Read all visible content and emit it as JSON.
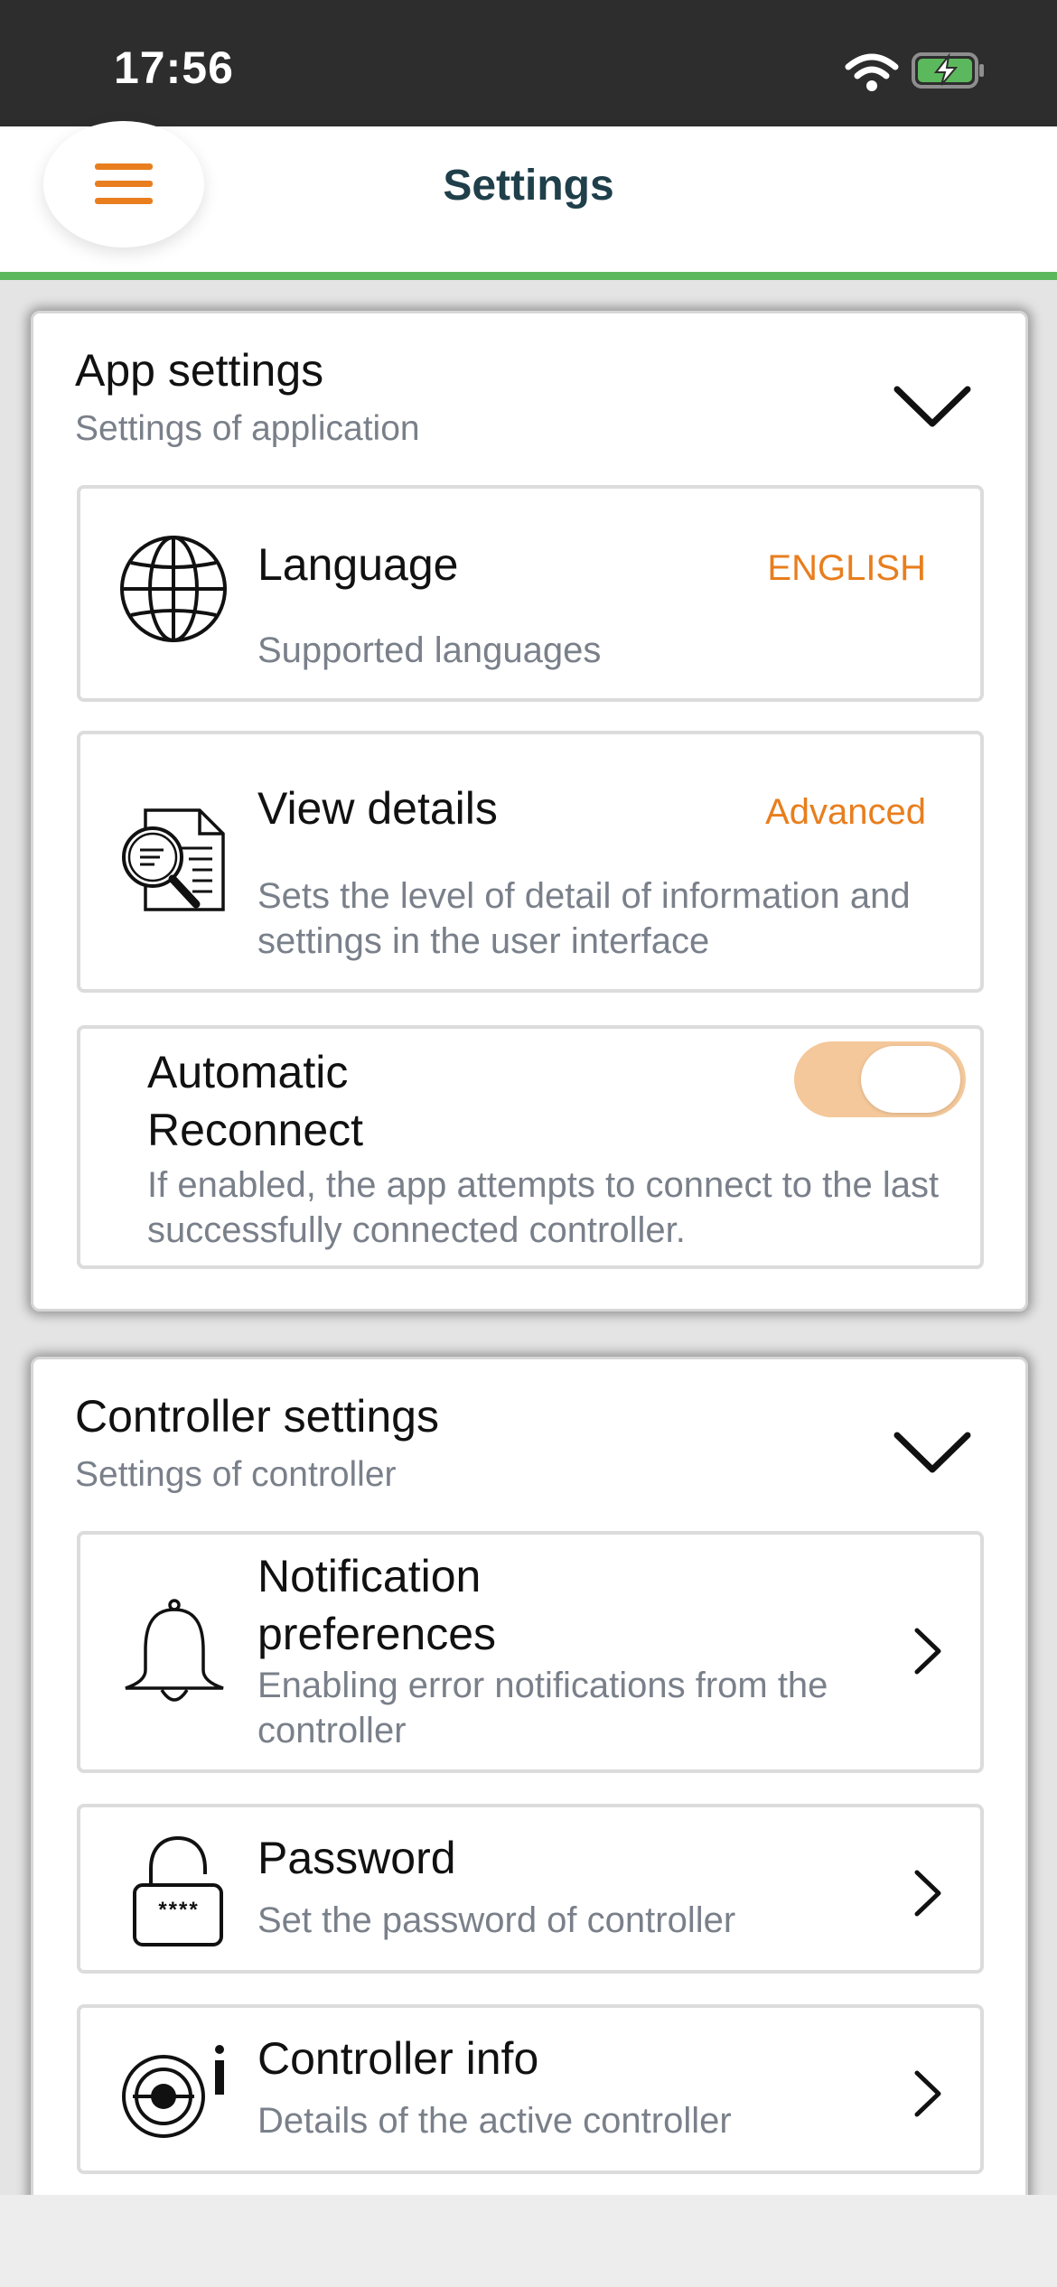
{
  "status_bar": {
    "time": "17:56",
    "icons": [
      "wifi-icon",
      "battery-charging-icon"
    ],
    "battery_color": "#5cb85c"
  },
  "header": {
    "title": "Settings",
    "menu_icon": "hamburger-menu-icon",
    "accent_color": "#e87e1e",
    "underline_color": "#5cb85c"
  },
  "app_settings": {
    "title": "App settings",
    "subtitle": "Settings of application",
    "expand_icon": "chevron-down-icon",
    "items": [
      {
        "icon": "globe-icon",
        "title": "Language",
        "value": "ENGLISH",
        "description": "Supported languages"
      },
      {
        "icon": "document-search-icon",
        "title": "View details",
        "value": "Advanced",
        "description": "Sets the level of detail of information and settings in the user interface"
      }
    ],
    "auto_reconnect": {
      "title": "Automatic Reconnect",
      "description": "If enabled, the app attempts to connect to the last successfully connected controller.",
      "enabled": true
    }
  },
  "controller_settings": {
    "title": "Controller settings",
    "subtitle": "Settings of controller",
    "expand_icon": "chevron-down-icon",
    "items": [
      {
        "icon": "bell-icon",
        "title": "Notification preferences",
        "description": "Enabling error notifications from the controller"
      },
      {
        "icon": "lock-password-icon",
        "title": "Password",
        "description": "Set the password of controller",
        "icon_text": "****"
      },
      {
        "icon": "controller-info-icon",
        "title": "Controller info",
        "description": "Details of the active controller"
      }
    ]
  }
}
